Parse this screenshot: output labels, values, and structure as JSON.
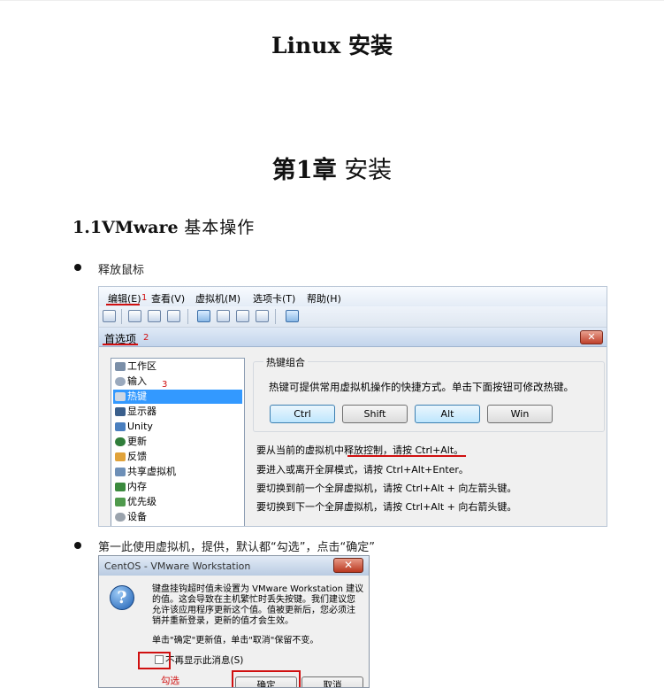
{
  "doc": {
    "title": "Linux 安装",
    "chapter_num": "第1章",
    "chapter_text": "安装",
    "section_num": "1.1VMware",
    "section_text": "基本操作",
    "bullet1": "释放鼠标",
    "bullet2": "第一此使用虚拟机，提供，默认都“勾选”，点击“确定”"
  },
  "prefs_window": {
    "menu": [
      "编辑(E)",
      "查看(V)",
      "虚拟机(M)",
      "选项卡(T)",
      "帮助(H)"
    ],
    "dialog_title": "首选项",
    "close_label": "✕",
    "tree_items": [
      "工作区",
      "输入",
      "热键",
      "显示器",
      "Unity",
      "更新",
      "反馈",
      "共享虚拟机",
      "内存",
      "优先级",
      "设备"
    ],
    "selected_item": "热键",
    "group_label": "热键组合",
    "group_desc": "热键可提供常用虚拟机操作的快捷方式。单击下面按钮可修改热键。",
    "key_buttons": [
      "Ctrl",
      "Shift",
      "Alt",
      "Win"
    ],
    "hints": [
      "要从当前的虚拟机中释放控制，请按 Ctrl+Alt。",
      "要进入或离开全屏模式，请按 Ctrl+Alt+Enter。",
      "要切换到前一个全屏虚拟机，请按 Ctrl+Alt + 向左箭头键。",
      "要切换到下一个全屏虚拟机，请按 Ctrl+Alt + 向右箭头键。"
    ],
    "annotations": [
      "1",
      "2",
      "3"
    ]
  },
  "centos_dialog": {
    "title": "CentOS - VMware Workstation",
    "close_label": "✕",
    "message_lines": [
      "键盘挂钩超时值未设置为 VMware Workstation 建议",
      "的值。这会导致在主机繁忙时丢失按键。我们建议您",
      "允许该应用程序更新这个值。值被更新后，您必须注",
      "销并重新登录，更新的值才会生效。"
    ],
    "message_tail": "单击\"确定\"更新值，单击\"取消\"保留不变。",
    "checkbox_label": "不再显示此消息(S)",
    "annotation": "勾选",
    "ok_label": "确定",
    "cancel_label": "取消"
  },
  "colors": {
    "annotation_red": "#d01010",
    "selection_blue": "#3399ff"
  }
}
